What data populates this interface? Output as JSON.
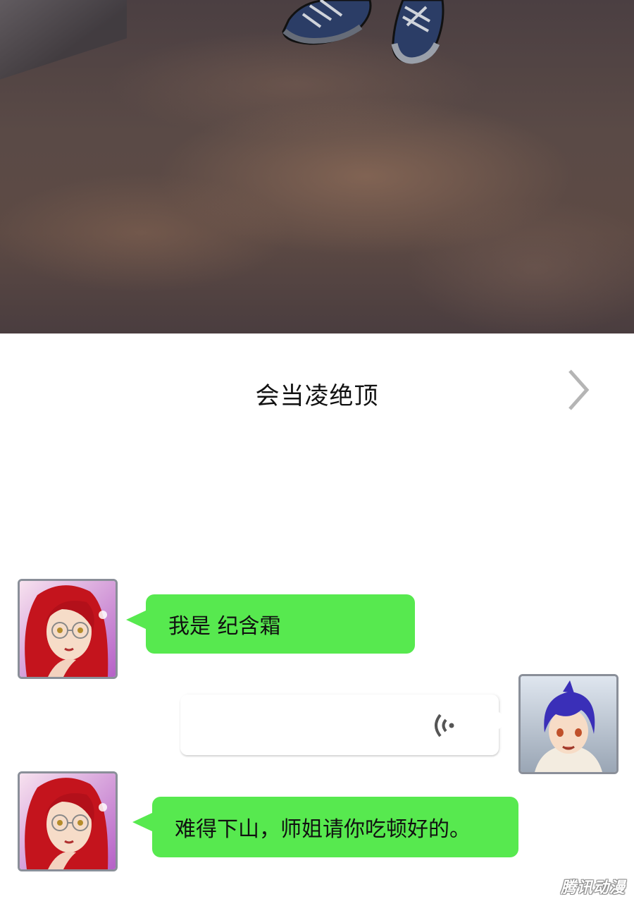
{
  "chat": {
    "title": "会当凌绝顶"
  },
  "messages": [
    {
      "sender": "纪含霜",
      "side": "left",
      "type": "text",
      "text": "我是 纪含霜"
    },
    {
      "sender": "me",
      "side": "right",
      "type": "voice",
      "icon": "voice-wave-icon"
    },
    {
      "sender": "纪含霜",
      "side": "left",
      "type": "text",
      "text": "难得下山，师姐请你吃顿好的。"
    }
  ],
  "watermark": "腾讯动漫",
  "colors": {
    "bubble_green": "#57e94f",
    "avatar_border": "#8a8f99",
    "chevron": "#b5b5b5"
  }
}
